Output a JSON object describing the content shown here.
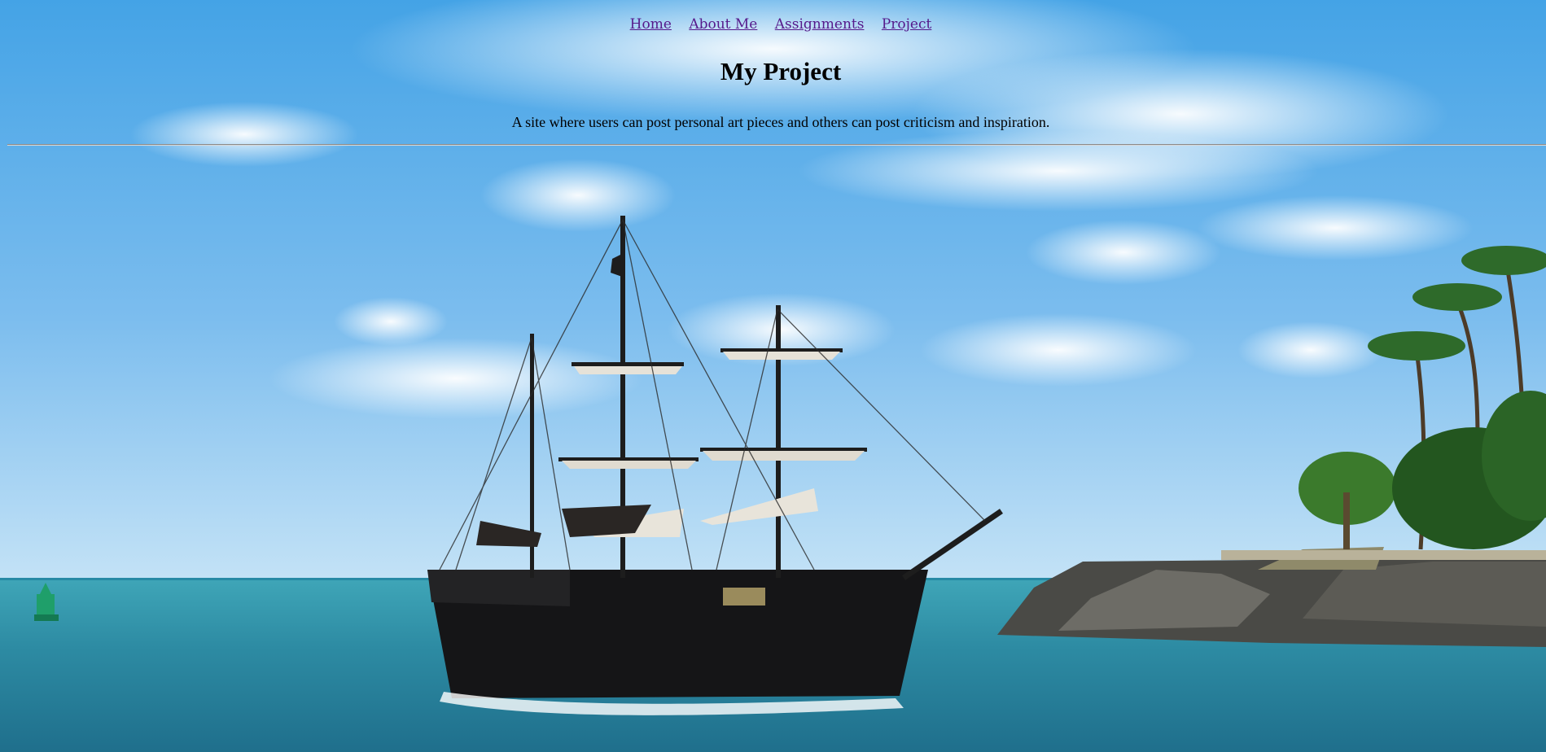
{
  "nav": {
    "links": [
      {
        "label": "Home"
      },
      {
        "label": "About Me"
      },
      {
        "label": "Assignments"
      },
      {
        "label": "Project"
      }
    ]
  },
  "header": {
    "title": "My Project",
    "description": "A site where users can post personal art pieces and others can post criticism and inspiration."
  },
  "colors": {
    "link": "#551a8b",
    "sky_top": "#4aa7e8",
    "sky_bottom": "#a9d4f3",
    "sea": "#2b8fa8",
    "ship": "#1a1a1c"
  },
  "background": {
    "image": "pirate-ship-harbor-photo"
  }
}
